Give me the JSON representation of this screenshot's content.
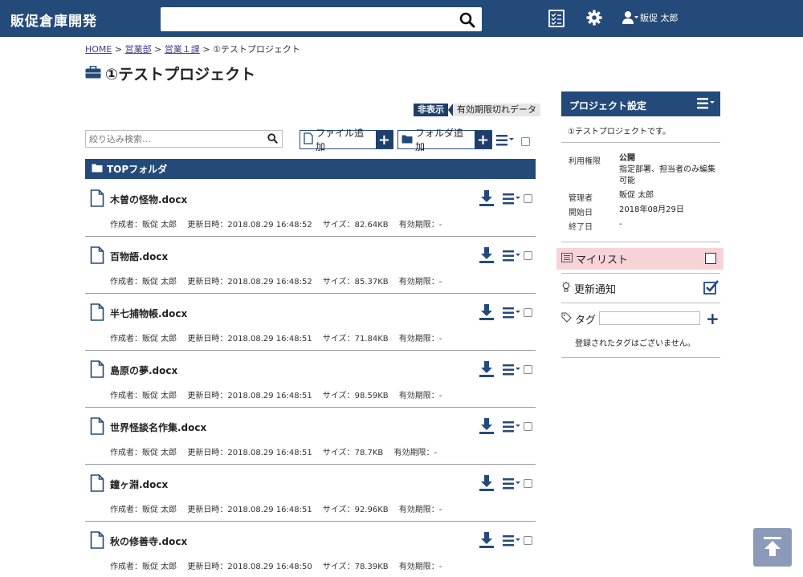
{
  "header": {
    "app_title": "販促倉庫開発",
    "search_placeholder": "",
    "user_name": "販促 太郎"
  },
  "breadcrumb": {
    "items": [
      "HOME",
      "営業部",
      "営業１課"
    ],
    "current": "①テストプロジェクト",
    "separator": ">"
  },
  "page_title": "①テストプロジェクト",
  "expired_toggle": {
    "button": "非表示",
    "label": "有効期限切れデータ"
  },
  "filter": {
    "placeholder": "絞り込み検索..."
  },
  "actions": {
    "add_file": "ファイル追加",
    "add_folder": "フォルダ追加"
  },
  "folder": {
    "name": "TOPフォルダ"
  },
  "files": [
    {
      "name": "木曽の怪物.docx",
      "meta": "作成者：販促 太郎　 更新日時：2018.08.29 16:48:52　 サイズ：82.64KB　 有効期限：-"
    },
    {
      "name": "百物語.docx",
      "meta": "作成者：販促 太郎　 更新日時：2018.08.29 16:48:52　 サイズ：85.37KB　 有効期限：-"
    },
    {
      "name": "半七捕物帳.docx",
      "meta": "作成者：販促 太郎　 更新日時：2018.08.29 16:48:51　 サイズ：71.84KB　 有効期限：-"
    },
    {
      "name": "島原の夢.docx",
      "meta": "作成者：販促 太郎　 更新日時：2018.08.29 16:48:51　 サイズ：98.59KB　 有効期限：-"
    },
    {
      "name": "世界怪談名作集.docx",
      "meta": "作成者：販促 太郎　 更新日時：2018.08.29 16:48:51　 サイズ：78.7KB　 有効期限：-"
    },
    {
      "name": "鐘ヶ淵.docx",
      "meta": "作成者：販促 太郎　 更新日時：2018.08.29 16:48:51　 サイズ：92.96KB　 有効期限：-"
    },
    {
      "name": "秋の修善寺.docx",
      "meta": "作成者：販促 太郎　 更新日時：2018.08.29 16:48:50　 サイズ：78.39KB　 有効期限：-"
    }
  ],
  "panel": {
    "title": "プロジェクト設定",
    "description": "①テストプロジェクトです。",
    "props": {
      "permission_key": "利用権限",
      "permission_value": "公開",
      "permission_note": "指定部署、担当者のみ編集可能",
      "admin_key": "管理者",
      "admin_value": "販促 太郎",
      "start_key": "開始日",
      "start_value": "2018年08月29日",
      "end_key": "終了日",
      "end_value": "-"
    },
    "mylist": "マイリスト",
    "notify": "更新通知",
    "tag_label": "タグ",
    "tag_empty": "登録されたタグはございません。"
  },
  "colors": {
    "navy": "#244a7a",
    "mylist_bg": "#f7d3d8"
  }
}
